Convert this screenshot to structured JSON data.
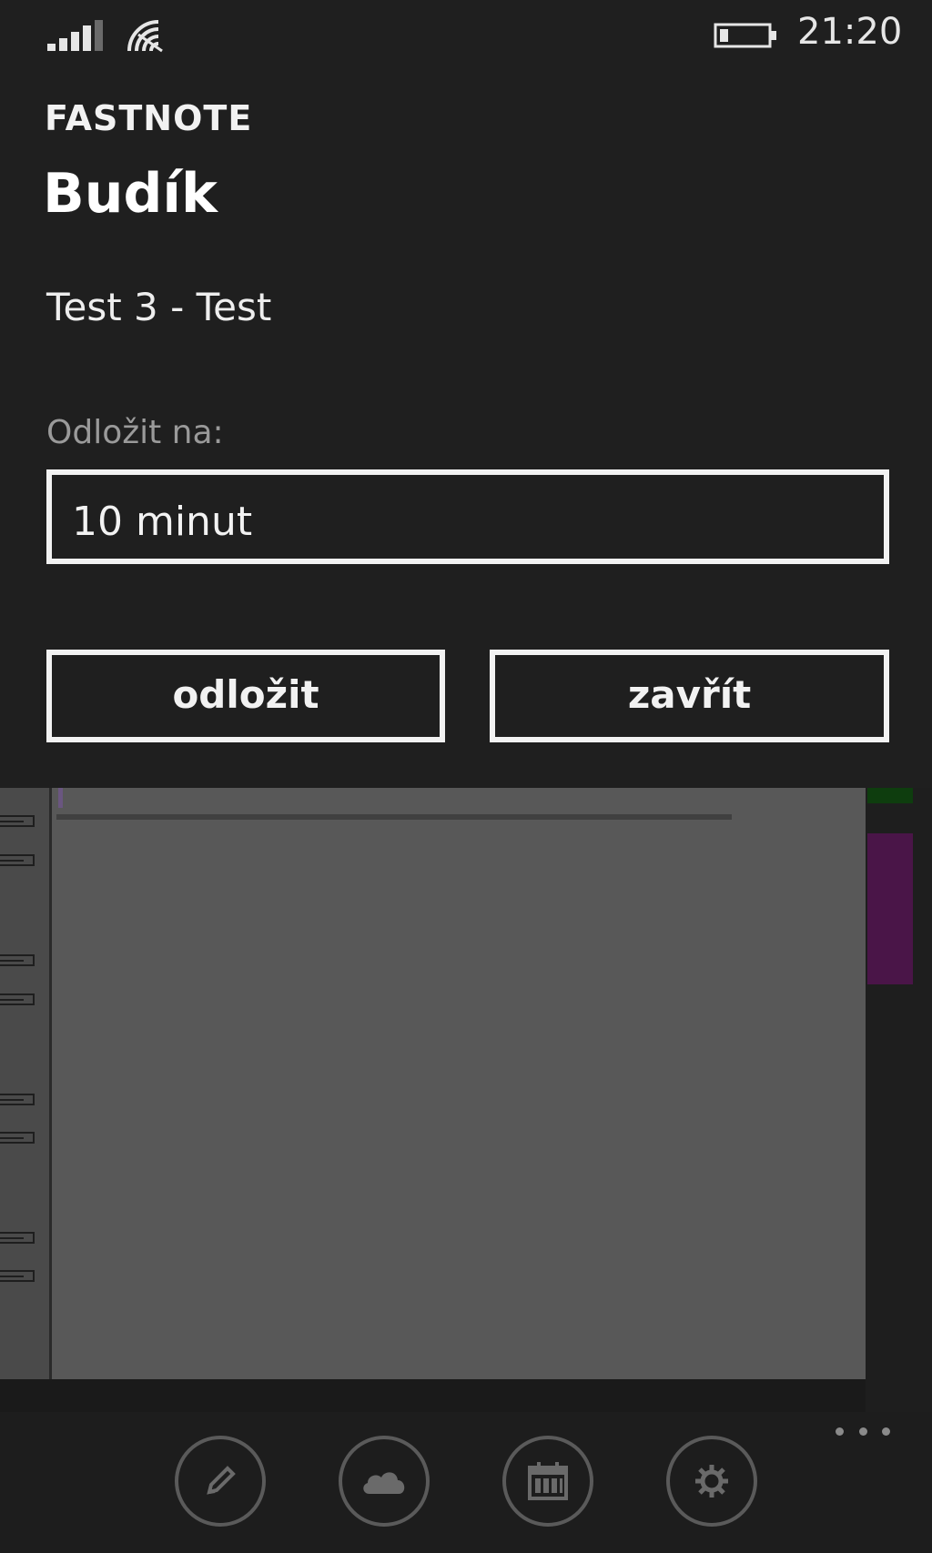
{
  "status_bar": {
    "time": "21:20"
  },
  "dialog": {
    "app_name": "FASTNOTE",
    "title": "Budík",
    "message": "Test 3 - Test",
    "snooze_label": "Odložit na:",
    "snooze_value": "10 minut",
    "snooze_button": "odložit",
    "close_button": "zavřít"
  },
  "app_bar": {
    "buttons": [
      {
        "icon": "pencil-icon"
      },
      {
        "icon": "cloud-icon"
      },
      {
        "icon": "calendar-icon"
      },
      {
        "icon": "gear-icon"
      }
    ],
    "more_icon": "ellipsis-icon"
  },
  "colors": {
    "dialog_background": "#1f1f1f",
    "accent_purple": "#4a1548",
    "accent_green": "#0e3d0e",
    "foreground": "#f2f2f2"
  }
}
